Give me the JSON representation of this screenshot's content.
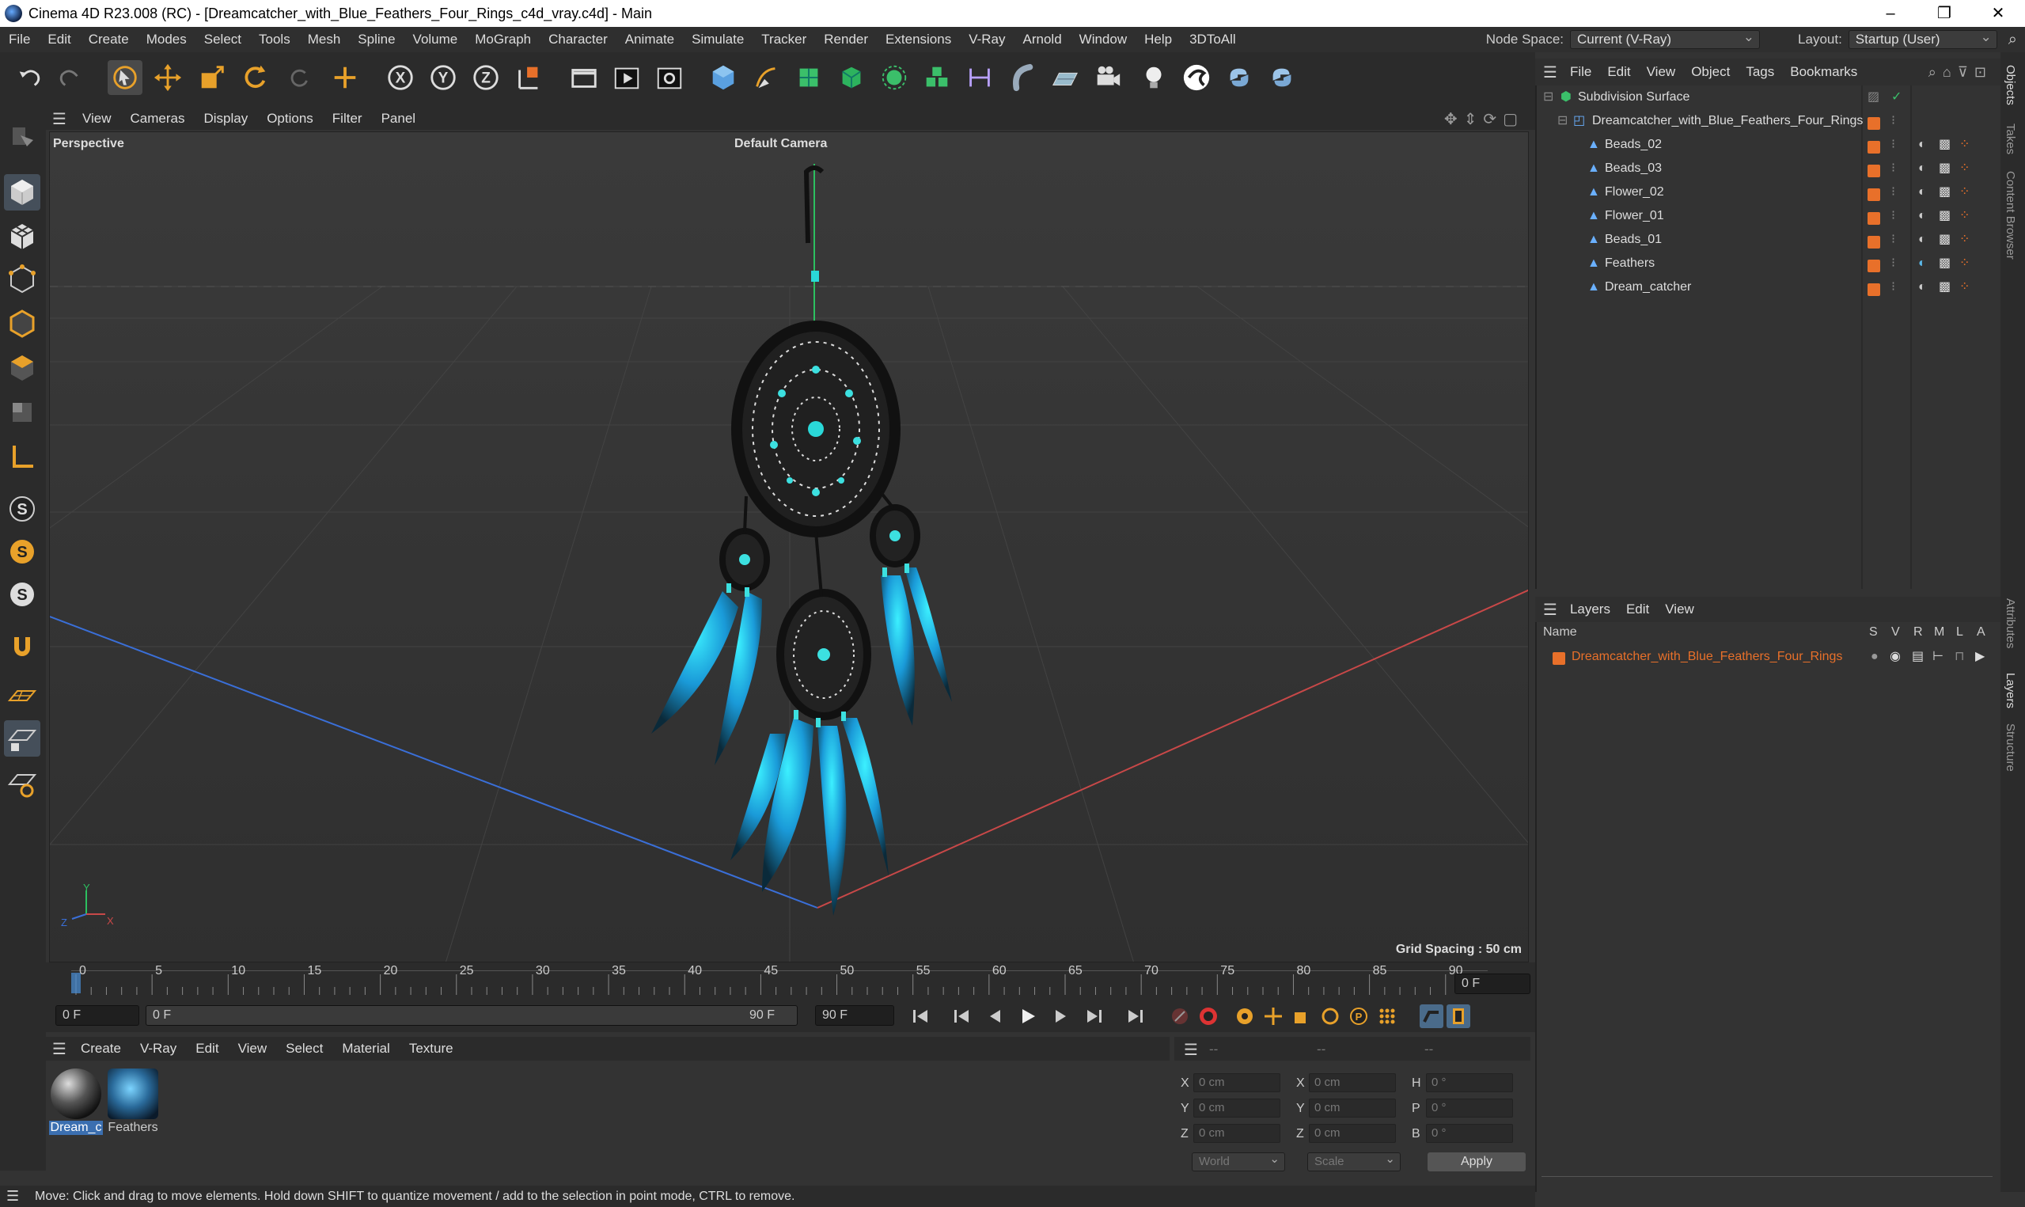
{
  "window": {
    "title": "Cinema 4D R23.008 (RC) - [Dreamcatcher_with_Blue_Feathers_Four_Rings_c4d_vray.c4d] - Main",
    "controls": [
      "–",
      "❐",
      "✕"
    ]
  },
  "menubar": {
    "items": [
      "File",
      "Edit",
      "Create",
      "Modes",
      "Select",
      "Tools",
      "Mesh",
      "Spline",
      "Volume",
      "MoGraph",
      "Character",
      "Animate",
      "Simulate",
      "Tracker",
      "Render",
      "Extensions",
      "V-Ray",
      "Arnold",
      "Window",
      "Help",
      "3DToAll"
    ],
    "node_space_label": "Node Space:",
    "node_space_value": "Current (V-Ray)",
    "layout_label": "Layout:",
    "layout_value": "Startup (User)"
  },
  "toolbar": {
    "icons": [
      "undo-icon",
      "redo-icon",
      "live-selection-icon",
      "move-icon",
      "scale-icon",
      "rotate-icon",
      "recent-tool-icon",
      "add-icon",
      "x-axis-icon",
      "y-axis-icon",
      "z-axis-icon",
      "coordinate-system-icon",
      "render-region-icon",
      "render-view-icon",
      "render-settings-icon",
      "cube-icon",
      "pen-icon",
      "subdivision-icon",
      "extrude-icon",
      "cloner-icon",
      "mograph-icon",
      "deformer-icon",
      "deformer-bend-icon",
      "floor-icon",
      "camera-icon",
      "light-icon",
      "vray-icon",
      "python-icon",
      "python2-icon"
    ]
  },
  "viewport": {
    "menu": [
      "View",
      "Cameras",
      "Display",
      "Options",
      "Filter",
      "Panel"
    ],
    "projection": "Perspective",
    "camera": "Default Camera",
    "grid_spacing": "Grid Spacing : 50 cm",
    "axis_labels": {
      "x": "X",
      "y": "Y",
      "z": "Z"
    }
  },
  "timeline": {
    "ticks": [
      "0",
      "5",
      "10",
      "15",
      "20",
      "25",
      "30",
      "35",
      "40",
      "45",
      "50",
      "55",
      "60",
      "65",
      "70",
      "75",
      "80",
      "85",
      "90"
    ],
    "current_frame": "0 F",
    "start_frame": "0 F",
    "range_start": "0 F",
    "range_end": "90 F",
    "end_frame": "90 F"
  },
  "materials": {
    "menu": [
      "Create",
      "V-Ray",
      "Edit",
      "View",
      "Select",
      "Material",
      "Texture"
    ],
    "items": [
      {
        "name": "Dream_c"
      },
      {
        "name": "Feathers"
      }
    ]
  },
  "coordinates": {
    "header_left": "--",
    "header_mid": "--",
    "header_right": "--",
    "rows": [
      {
        "axis": "X",
        "pos": "0 cm",
        "axis2": "X",
        "size": "0 cm",
        "axis3": "H",
        "rot": "0 °"
      },
      {
        "axis": "Y",
        "pos": "0 cm",
        "axis2": "Y",
        "size": "0 cm",
        "axis3": "P",
        "rot": "0 °"
      },
      {
        "axis": "Z",
        "pos": "0 cm",
        "axis2": "Z",
        "size": "0 cm",
        "axis3": "B",
        "rot": "0 °"
      }
    ],
    "space": "World",
    "mode": "Scale",
    "apply": "Apply"
  },
  "status": "Move: Click and drag to move elements. Hold down SHIFT to quantize movement / add to the selection in point mode, CTRL to remove.",
  "object_manager": {
    "menu": [
      "File",
      "Edit",
      "View",
      "Object",
      "Tags",
      "Bookmarks"
    ],
    "objects": [
      {
        "name": "Subdivision Surface"
      },
      {
        "name": "Dreamcatcher_with_Blue_Feathers_Four_Rings"
      },
      {
        "name": "Beads_02"
      },
      {
        "name": "Beads_03"
      },
      {
        "name": "Flower_02"
      },
      {
        "name": "Flower_01"
      },
      {
        "name": "Beads_01"
      },
      {
        "name": "Feathers"
      },
      {
        "name": "Dream_catcher"
      }
    ]
  },
  "layers": {
    "menu": [
      "Layers",
      "Edit",
      "View"
    ],
    "columns": {
      "name": "Name",
      "s": "S",
      "v": "V",
      "r": "R",
      "m": "M",
      "l": "L",
      "a": "A"
    },
    "items": [
      {
        "name": "Dreamcatcher_with_Blue_Feathers_Four_Rings"
      }
    ]
  },
  "side_tabs": [
    "Objects",
    "Takes",
    "Content Browser",
    "Attributes",
    "Layers",
    "Structure"
  ],
  "colors": {
    "accent": "#e8702a",
    "selection": "#4a90d9",
    "bg": "#333333"
  }
}
